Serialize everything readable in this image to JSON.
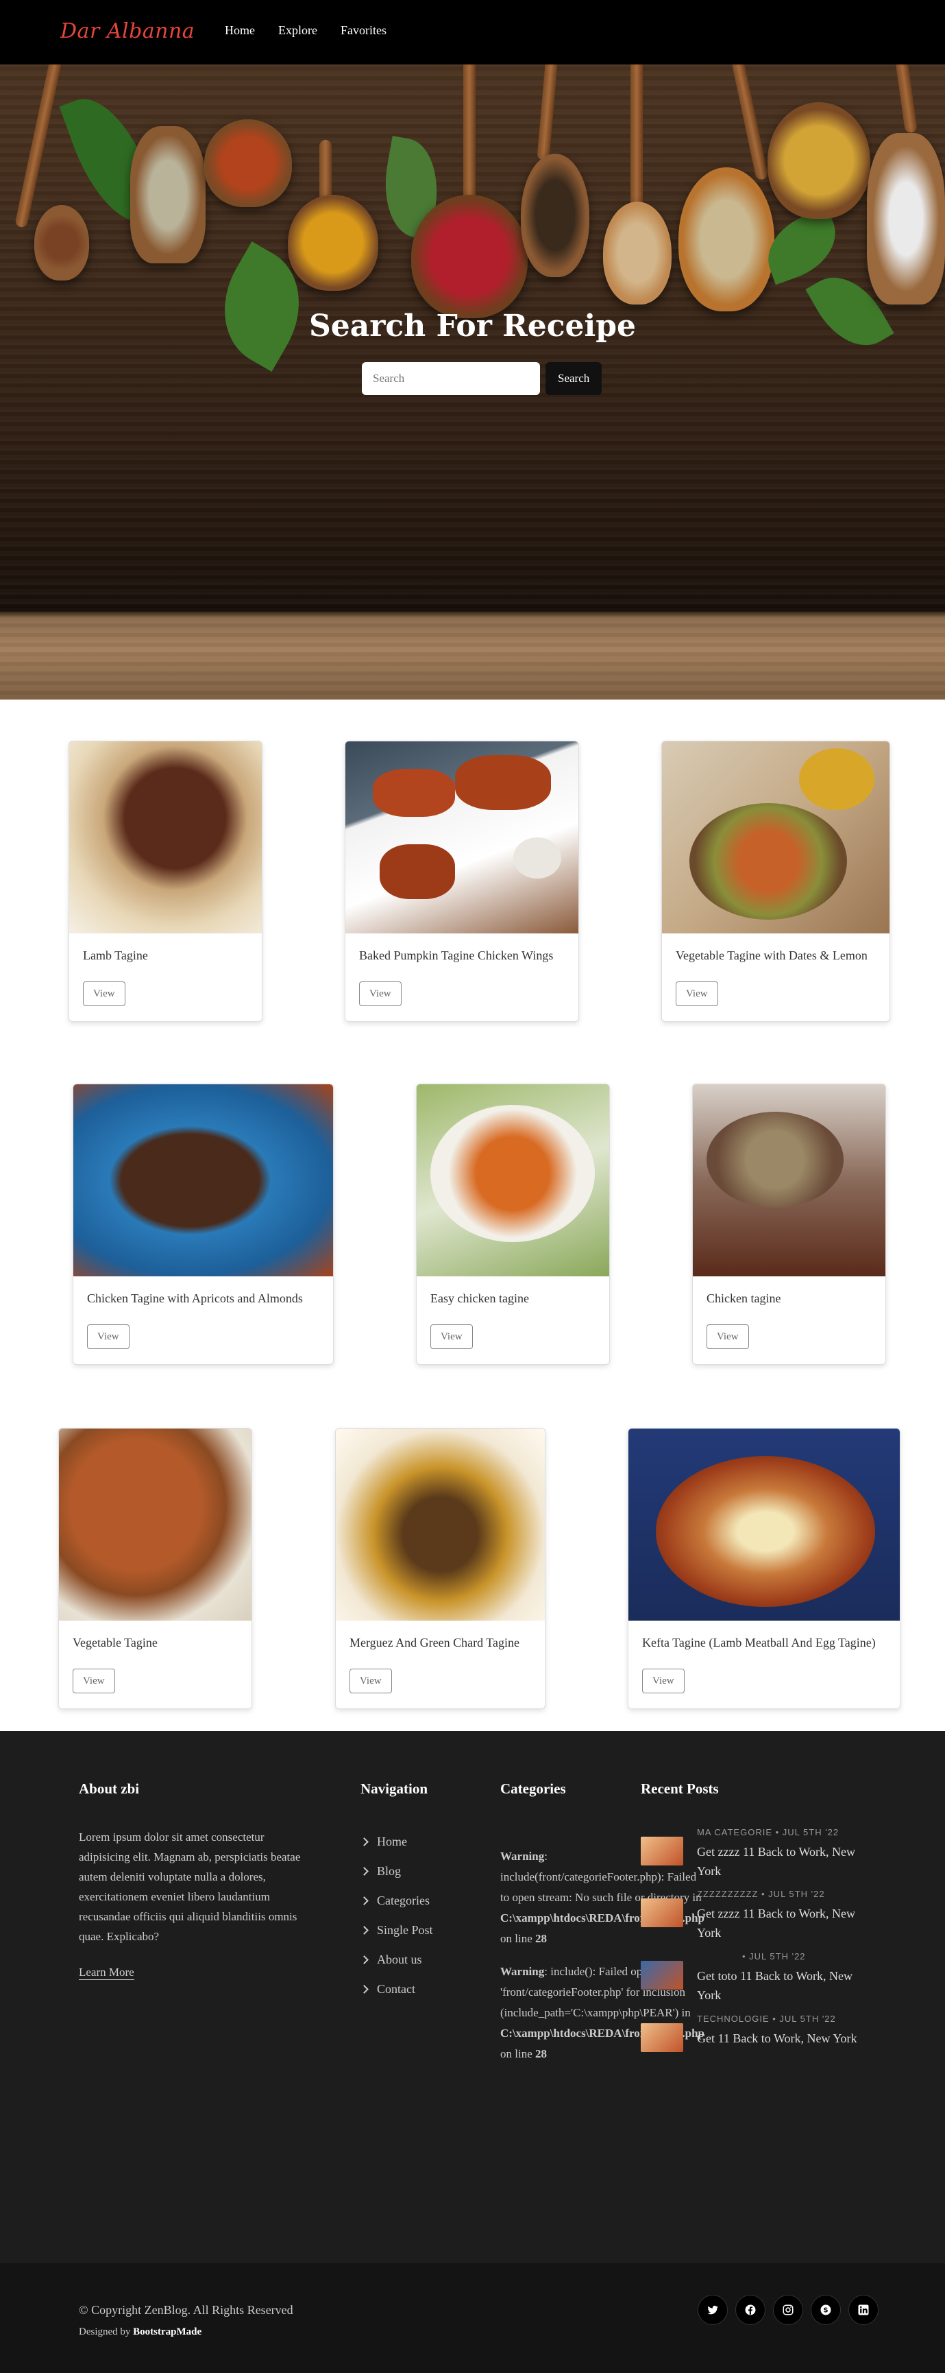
{
  "brand": "Dar Albanna",
  "nav": [
    "Home",
    "Explore",
    "Favorites"
  ],
  "hero": {
    "title": "Search For Receipe",
    "search_placeholder": "Search",
    "search_button": "Search"
  },
  "recipes": [
    {
      "title": "Lamb Tagine",
      "view": "View"
    },
    {
      "title": "Baked Pumpkin Tagine Chicken Wings",
      "view": "View"
    },
    {
      "title": "Vegetable Tagine with Dates & Lemon",
      "view": "View"
    },
    {
      "title": "Chicken Tagine with Apricots and Almonds",
      "view": "View"
    },
    {
      "title": "Easy chicken tagine",
      "view": "View"
    },
    {
      "title": "Chicken tagine",
      "view": "View"
    },
    {
      "title": "Vegetable Tagine",
      "view": "View"
    },
    {
      "title": "Merguez And Green Chard Tagine",
      "view": "View"
    },
    {
      "title": "Kefta Tagine (Lamb Meatball And Egg Tagine)",
      "view": "View"
    }
  ],
  "footer": {
    "about": {
      "heading": "About zbi",
      "text": "Lorem ipsum dolor sit amet consectetur adipisicing elit. Magnam ab, perspiciatis beatae autem deleniti voluptate nulla a dolores, exercitationem eveniet libero laudantium recusandae officiis qui aliquid blanditiis omnis quae. Explicabo?",
      "link": "Learn More"
    },
    "navigation": {
      "heading": "Navigation",
      "items": [
        "Home",
        "Blog",
        "Categories",
        "Single Post",
        "About us",
        "Contact"
      ]
    },
    "categories": {
      "heading": "Categories",
      "warning1_label": "Warning",
      "warning1_text": ": include(front/categorieFooter.php): Failed to open stream: No such file or directory in",
      "warning1_path": "C:\\xampp\\htdocs\\REDA\\front\\footer.php",
      "warning1_line_prefix": "on line",
      "warning1_line": "28",
      "warning2_label": "Warning",
      "warning2_text": ": include(): Failed opening 'front/categorieFooter.php' for inclusion (include_path='C:\\xampp\\php\\PEAR') in",
      "warning2_path": "C:\\xampp\\htdocs\\REDA\\front\\footer.php",
      "warning2_line_prefix": "on line",
      "warning2_line": "28"
    },
    "recent_posts": {
      "heading": "Recent Posts",
      "posts": [
        {
          "meta": "MA CATEGORIE  •  JUL 5TH '22",
          "title": "Get zzzz 11 Back to Work, New York"
        },
        {
          "meta": "ZZZZZZZZZZ  •  JUL 5TH '22",
          "title": "Get zzzz 11 Back to Work, New York"
        },
        {
          "meta": "•  JUL 5TH '22",
          "title": "Get toto 11 Back to Work, New York"
        },
        {
          "meta": "TECHNOLOGIE  •  JUL 5TH '22",
          "title": "Get 11 Back to Work, New York"
        }
      ]
    },
    "copyright": "© Copyright ZenBlog. All Rights Reserved",
    "designed_prefix": "Designed by",
    "designed_by": "BootstrapMade",
    "socials": [
      "twitter-icon",
      "facebook-icon",
      "instagram-icon",
      "skype-icon",
      "linkedin-icon"
    ]
  }
}
